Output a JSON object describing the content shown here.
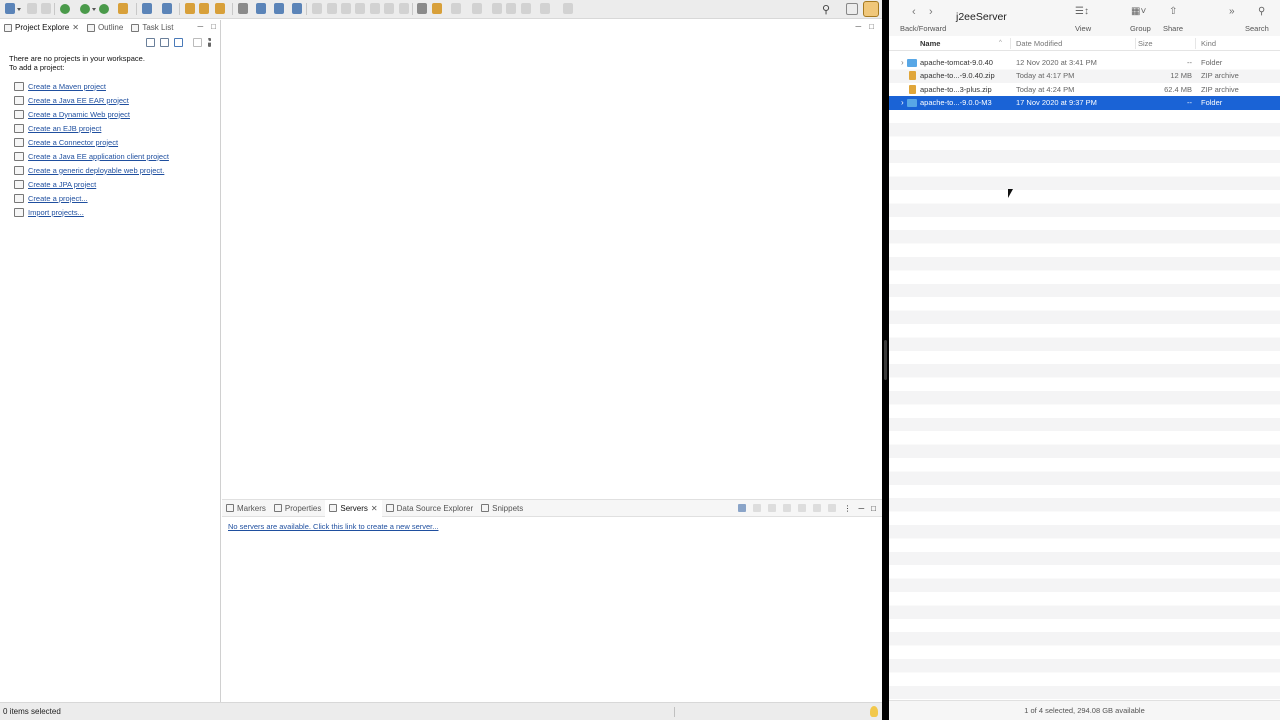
{
  "eclipse": {
    "left_tabs": [
      {
        "label": "Project Explore",
        "active": true
      },
      {
        "label": "Outline",
        "active": false
      },
      {
        "label": "Task List",
        "active": false
      }
    ],
    "empty_msg_line1": "There are no projects in your workspace.",
    "empty_msg_line2": "To add a project:",
    "project_links": [
      "Create a Maven project",
      "Create a Java EE EAR project",
      "Create a Dynamic Web project",
      "Create an EJB project",
      "Create a Connector project",
      "Create a Java EE application client project",
      "Create a generic deployable web project.",
      "Create a JPA project",
      "Create a project...",
      "Import projects..."
    ],
    "bottom_tabs": [
      {
        "label": "Markers",
        "active": false
      },
      {
        "label": "Properties",
        "active": false
      },
      {
        "label": "Servers",
        "active": true
      },
      {
        "label": "Data Source Explorer",
        "active": false
      },
      {
        "label": "Snippets",
        "active": false
      }
    ],
    "servers_link": "No servers are available. Click this link to create a new server...",
    "status_text": "0 items selected"
  },
  "finder": {
    "back_forward_label": "Back/Forward",
    "title": "j2eeServer",
    "toolbar": {
      "view_label": "View",
      "group_label": "Group",
      "share_label": "Share",
      "search_label": "Search"
    },
    "columns": {
      "name": "Name",
      "date": "Date Modified",
      "size": "Size",
      "kind": "Kind"
    },
    "files": [
      {
        "name": "apache-tomcat-9.0.40",
        "date": "12 Nov 2020 at 3:41 PM",
        "size": "--",
        "kind": "Folder",
        "type": "folder",
        "selected": false
      },
      {
        "name": "apache-to...-9.0.40.zip",
        "date": "Today at 4:17 PM",
        "size": "12 MB",
        "kind": "ZIP archive",
        "type": "zip",
        "selected": false
      },
      {
        "name": "apache-to...3-plus.zip",
        "date": "Today at 4:24 PM",
        "size": "62.4 MB",
        "kind": "ZIP archive",
        "type": "zip",
        "selected": false
      },
      {
        "name": "apache-to...-9.0.0-M3",
        "date": "17 Nov 2020 at 9:37 PM",
        "size": "--",
        "kind": "Folder",
        "type": "folder",
        "selected": true
      }
    ],
    "status": "1 of 4 selected, 294.08 GB available"
  }
}
